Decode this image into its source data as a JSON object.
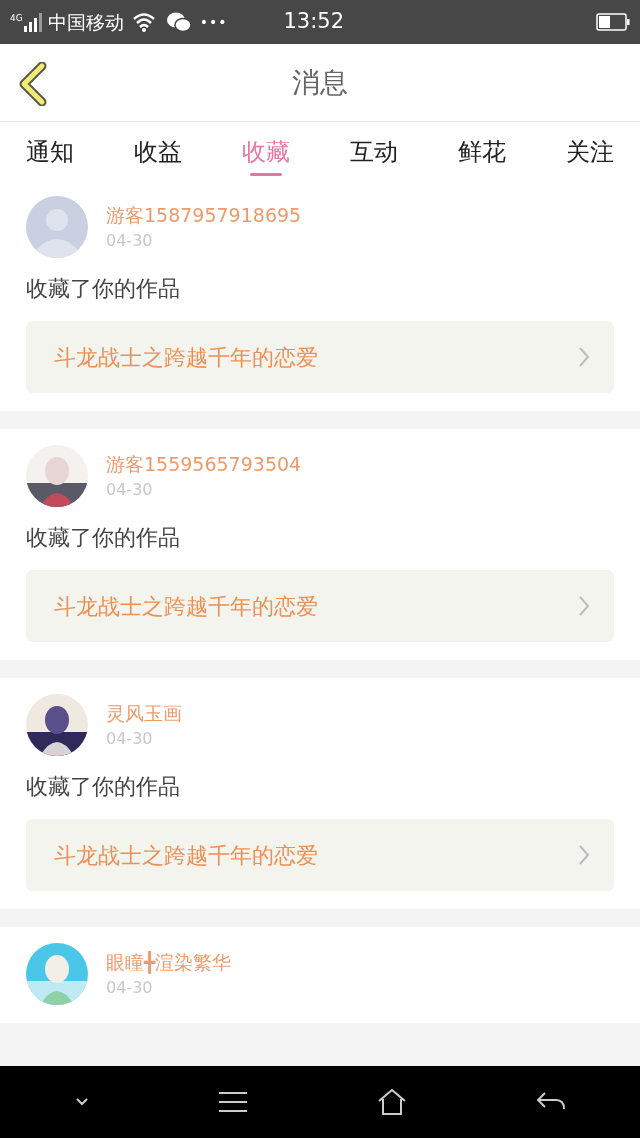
{
  "status_bar": {
    "network": "4G",
    "carrier": "中国移动",
    "more": "•••",
    "time": "13:52"
  },
  "header": {
    "title": "消息"
  },
  "tabs": [
    {
      "label": "通知",
      "selected": false
    },
    {
      "label": "收益",
      "selected": false
    },
    {
      "label": "收藏",
      "selected": true
    },
    {
      "label": "互动",
      "selected": false
    },
    {
      "label": "鲜花",
      "selected": false
    },
    {
      "label": "关注",
      "selected": false
    }
  ],
  "messages": [
    {
      "avatar": {
        "kind": "default"
      },
      "user": "游客1587957918695",
      "date": "04-30",
      "action": "收藏了你的作品",
      "work": "斗龙战士之跨越千年的恋爱"
    },
    {
      "user": "游客1559565793504",
      "date": "04-30",
      "action": "收藏了你的作品",
      "work": "斗龙战士之跨越千年的恋爱"
    },
    {
      "user": "灵风玉画",
      "date": "04-30",
      "action": "收藏了你的作品",
      "work": "斗龙战士之跨越千年的恋爱"
    },
    {
      "user": "眼瞳╋渲染繁华",
      "date": "04-30"
    }
  ]
}
